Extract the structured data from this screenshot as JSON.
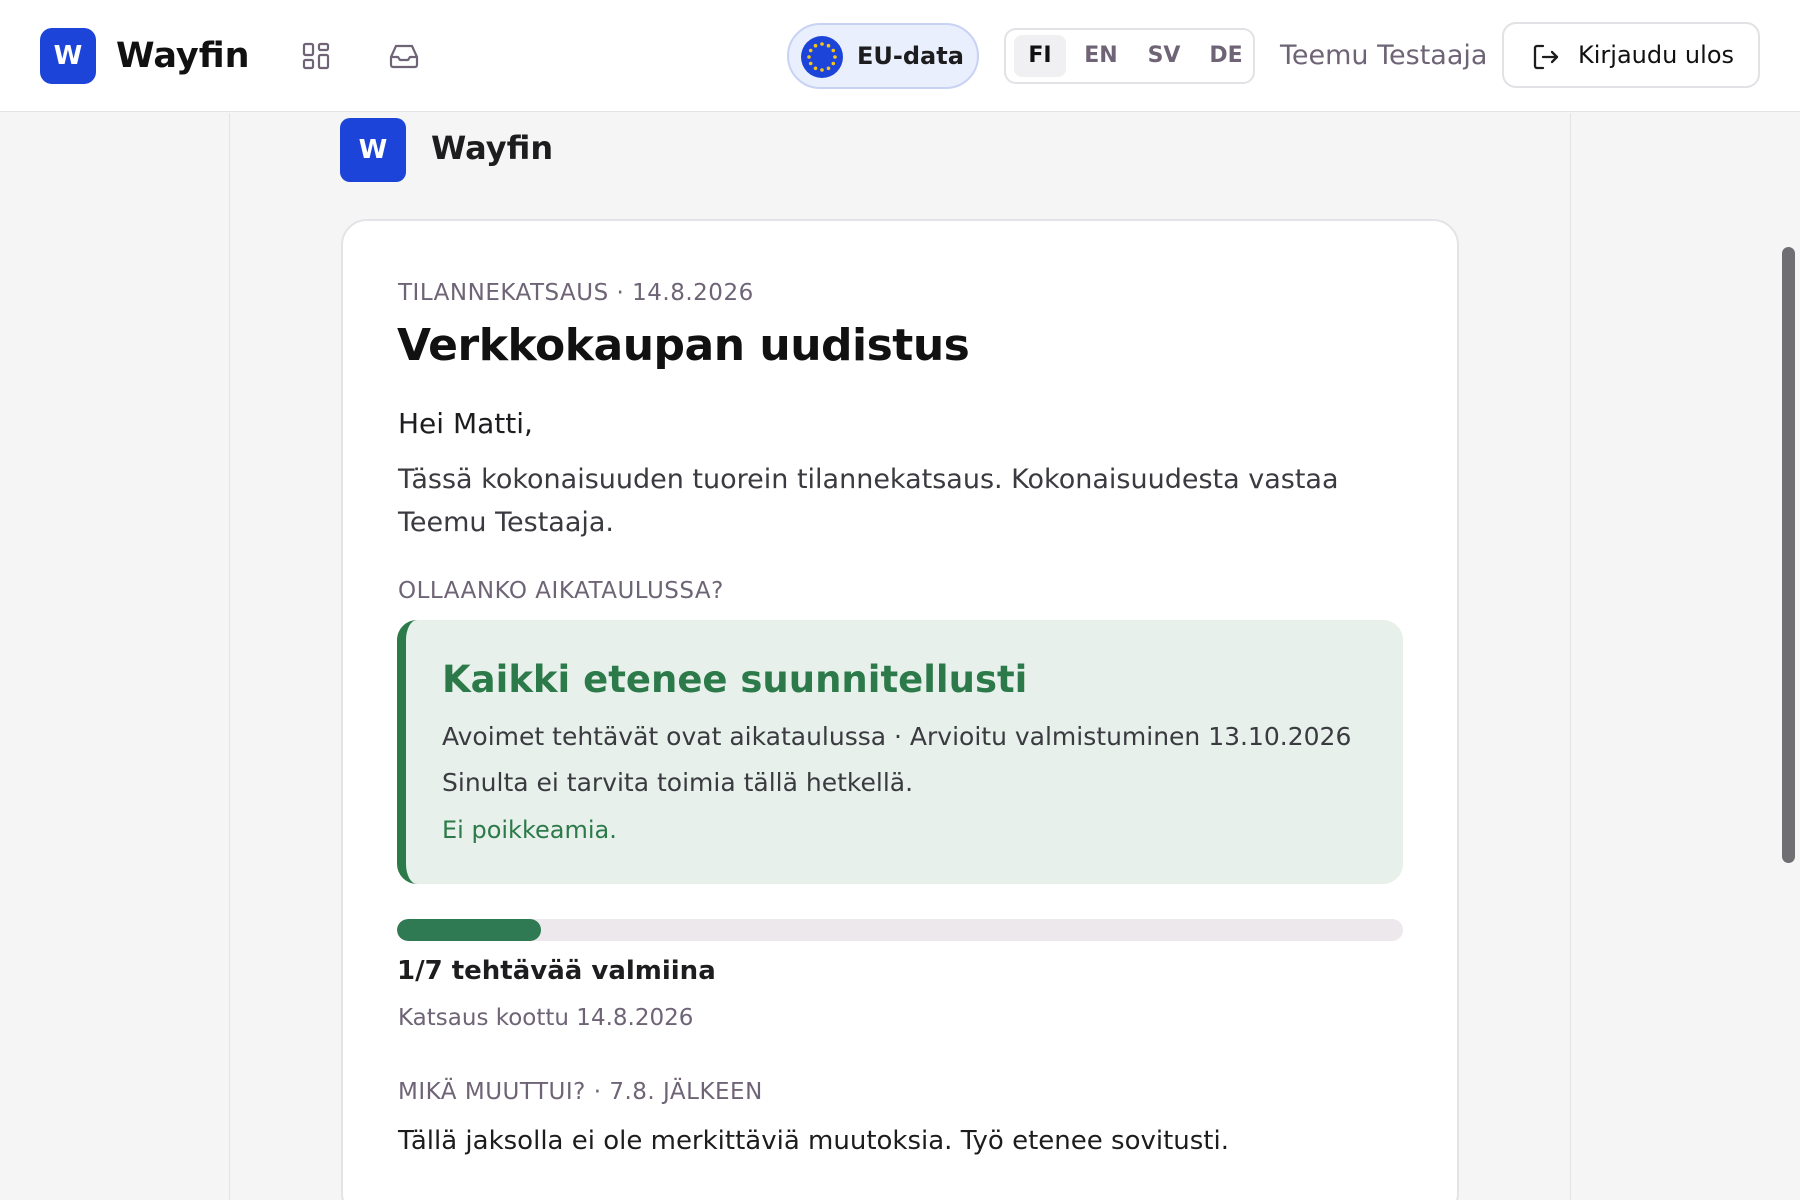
{
  "topbar": {
    "brand_initial": "W",
    "brand_name": "Wayfin",
    "nav_icons": [
      "grid-icon",
      "inbox-icon"
    ],
    "eu_label": "EU-data",
    "languages": [
      "FI",
      "EN",
      "SV",
      "DE"
    ],
    "active_language": "FI",
    "user_name": "Teemu Testaaja",
    "logout_label": "Kirjaudu ulos"
  },
  "org": {
    "initial": "W",
    "name": "Wayfin"
  },
  "report": {
    "eyebrow": "TILANNEKATSAUS · 14.8.2026",
    "title": "Verkkokaupan uudistus",
    "greeting": "Hei Matti,",
    "intro": "Tässä kokonaisuuden tuorein tilannekatsaus. Kokonaisuudesta vastaa Teemu Testaaja.",
    "schedule_heading": "OLLAANKO AIKATAULUSSA?",
    "status": {
      "title": "Kaikki etenee suunnitellusti",
      "line1": "Avoimet tehtävät ovat aikataulussa · Arvioitu valmistuminen 13.10.2026",
      "line2": "Sinulta ei tarvita toimia tällä hetkellä.",
      "note": "Ei poikkeamia.",
      "accent_color": "#2c7a4a",
      "background_color": "#e7f0ea"
    },
    "progress": {
      "done": 1,
      "total": 7,
      "label": "1/7 tehtävää valmiina"
    },
    "compiled": "Katsaus koottu 14.8.2026",
    "changes_heading": "MIKÄ MUUTTUI? · 7.8. JÄLKEEN",
    "changes_text": "Tällä jaksolla ei ole merkittäviä muutoksia. Työ etenee sovitusti."
  },
  "colors": {
    "brand": "#1d44d8",
    "eu_pill_bg": "#e9effd",
    "progress_fill": "#2f7a52"
  }
}
